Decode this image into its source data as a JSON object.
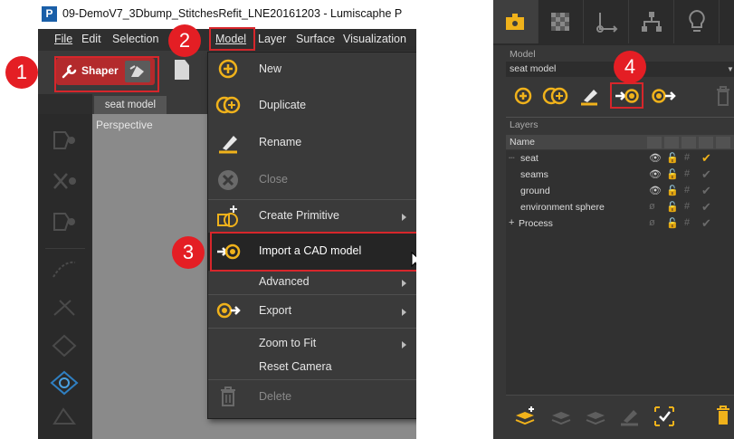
{
  "window": {
    "app_icon": "P",
    "title": "09-DemoV7_3Dbump_StitchesRefit_LNE20161203 - Lumiscaphe P"
  },
  "menubar": {
    "items": [
      "File",
      "Edit",
      "Selection",
      "Model",
      "Layer",
      "Surface",
      "Visualization"
    ]
  },
  "toolbar": {
    "shaper_label": "Shaper"
  },
  "tabs": {
    "seat_model": "seat model"
  },
  "viewport": {
    "label": "Perspective"
  },
  "model_menu": {
    "items": [
      {
        "label": "New",
        "icon": "new-model-icon",
        "enabled": true,
        "submenu": false
      },
      {
        "label": "Duplicate",
        "icon": "duplicate-icon",
        "enabled": true,
        "submenu": false
      },
      {
        "label": "Rename",
        "icon": "rename-icon",
        "enabled": true,
        "submenu": false
      },
      {
        "label": "Close",
        "icon": "close-icon",
        "enabled": false,
        "submenu": false
      },
      {
        "label": "Create Primitive",
        "icon": "create-primitive-icon",
        "enabled": true,
        "submenu": true
      },
      {
        "label": "Import a CAD model",
        "icon": "import-cad-icon",
        "enabled": true,
        "submenu": false,
        "highlighted": true
      },
      {
        "label": "Advanced",
        "icon": "",
        "enabled": true,
        "submenu": true
      },
      {
        "label": "Export",
        "icon": "export-icon",
        "enabled": true,
        "submenu": true
      },
      {
        "label": "Zoom to Fit",
        "icon": "",
        "enabled": true,
        "submenu": true
      },
      {
        "label": "Reset Camera",
        "icon": "",
        "enabled": true,
        "submenu": false
      },
      {
        "label": "Delete",
        "icon": "trash-icon",
        "enabled": false,
        "submenu": false
      }
    ]
  },
  "badges": [
    "1",
    "2",
    "3",
    "4"
  ],
  "right_panel": {
    "model_label": "Model",
    "model_value": "seat model",
    "layers_label": "Layers",
    "name_header": "Name",
    "layers": [
      {
        "name": "seat",
        "checked": true
      },
      {
        "name": "seams",
        "checked": false
      },
      {
        "name": "ground",
        "checked": false
      },
      {
        "name": "environment sphere",
        "checked": false
      },
      {
        "name": "Process",
        "checked": false
      }
    ]
  },
  "colors": {
    "accent_red": "#d7262b",
    "badge_red": "#e41e24",
    "icon_yellow": "#f0b21b",
    "menu_bg": "#3a3a3a"
  }
}
